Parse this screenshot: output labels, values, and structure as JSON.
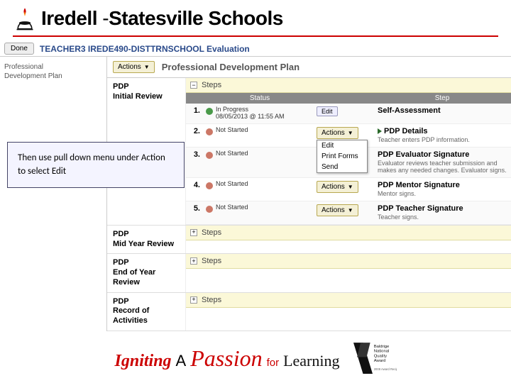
{
  "brand": {
    "name1": "Iredell",
    "dash": "-",
    "name2": "Statesville Schools"
  },
  "titlebar": {
    "done": "Done",
    "title": "TEACHER3 IREDE490-DISTTRNSCHOOL Evaluation"
  },
  "sidebar": {
    "items": [
      {
        "line1": "Professional",
        "line2": "Development Plan"
      }
    ]
  },
  "plan": {
    "actions_label": "Actions",
    "title": "Professional Development Plan"
  },
  "steps_section": {
    "label_expanded": "−",
    "label_collapsed": "+",
    "title": "Steps",
    "head_status": "Status",
    "head_step": "Step"
  },
  "reviews": [
    {
      "label1": "PDP",
      "label2": "Initial Review",
      "expanded": true
    },
    {
      "label1": "PDP",
      "label2": "Mid Year Review",
      "expanded": false
    },
    {
      "label1": "PDP",
      "label2": "End of Year Review",
      "expanded": false
    },
    {
      "label1": "PDP",
      "label2": "Record of Activities",
      "expanded": false
    }
  ],
  "steps": [
    {
      "num": "1.",
      "status_kind": "green",
      "status_text": "In Progress\n08/05/2013 @ 11:55 AM",
      "action_type": "edit",
      "action_label": "Edit",
      "name": "Self-Assessment",
      "desc": ""
    },
    {
      "num": "2.",
      "status_kind": "grey",
      "status_text": "Not Started",
      "action_type": "actions_open",
      "action_label": "Actions",
      "name": "PDP Details",
      "desc": "Teacher enters PDP information.",
      "arrow": true
    },
    {
      "num": "3.",
      "status_kind": "grey",
      "status_text": "Not Started",
      "action_type": "none",
      "name": "PDP Evaluator Signature",
      "desc": "Evaluator reviews teacher submission and makes any needed changes. Evaluator signs."
    },
    {
      "num": "4.",
      "status_kind": "grey",
      "status_text": "Not Started",
      "action_type": "actions",
      "action_label": "Actions",
      "name": "PDP Mentor Signature",
      "desc": "Mentor signs."
    },
    {
      "num": "5.",
      "status_kind": "grey",
      "status_text": "Not Started",
      "action_type": "actions",
      "action_label": "Actions",
      "name": "PDP Teacher Signature",
      "desc": "Teacher signs."
    }
  ],
  "dropdown": {
    "items": [
      "Edit",
      "Print Forms",
      "Send"
    ]
  },
  "callout": {
    "text": "Then use pull down menu under Action to select Edit"
  },
  "footer": {
    "igniting": "Igniting",
    "a": "A",
    "passion": "Passion",
    "for": "for",
    "learning": "Learning",
    "award1": "Baldrige",
    "award2": "National",
    "award3": "Quality",
    "award4": "Award",
    "award5": "2008 Award Recipient"
  }
}
